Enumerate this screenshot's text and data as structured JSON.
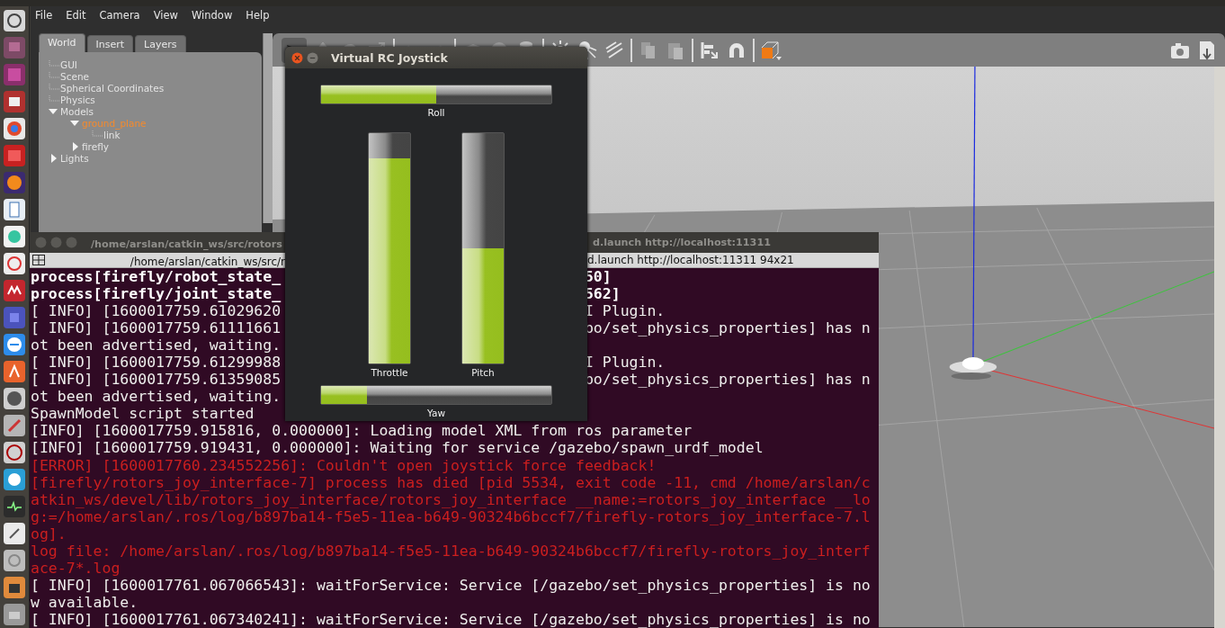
{
  "gazebo": {
    "menu": [
      "File",
      "Edit",
      "Camera",
      "View",
      "Window",
      "Help"
    ],
    "tabs": [
      {
        "label": "World",
        "selected": true
      },
      {
        "label": "Insert",
        "selected": false
      },
      {
        "label": "Layers",
        "selected": false
      }
    ],
    "tree": [
      {
        "label": "GUI",
        "selected": false
      },
      {
        "label": "Scene",
        "selected": false
      },
      {
        "label": "Spherical Coordinates",
        "selected": false
      },
      {
        "label": "Physics",
        "selected": false
      },
      {
        "label": "Models",
        "expanded": true,
        "selected": false,
        "children": [
          {
            "label": "ground_plane",
            "expanded": true,
            "selected": true,
            "children": [
              {
                "label": "link",
                "selected": false
              }
            ]
          },
          {
            "label": "firefly",
            "expanded": false,
            "selected": false
          }
        ]
      },
      {
        "label": "Lights",
        "expanded": false,
        "selected": false
      }
    ]
  },
  "terminal": {
    "title_left": "/home/arslan/catkin_ws/src/rotors",
    "title_right": "d.launch http://localhost:11311",
    "tab_left": "/home/arslan/catkin_ws/src/r",
    "tab_right": "d.launch http://localhost:11311 94x21",
    "lines": [
      {
        "kind": "bold",
        "left": "process[firefly/robot_state_",
        "right": "50]"
      },
      {
        "kind": "bold",
        "left": "process[firefly/joint_state_",
        "right": "562]"
      },
      {
        "kind": "normal",
        "left": "[ INFO] [1600017759.61029620",
        "right": "I Plugin."
      },
      {
        "kind": "normal",
        "left": "[ INFO] [1600017759.61111661",
        "right": "bo/set_physics_properties] has n"
      },
      {
        "kind": "normal",
        "left": "ot been advertised, waiting."
      },
      {
        "kind": "normal",
        "left": "[ INFO] [1600017759.61299988",
        "right": "I Plugin."
      },
      {
        "kind": "normal",
        "left": "[ INFO] [1600017759.61359085",
        "right": "bo/set_physics_properties] has n"
      },
      {
        "kind": "normal",
        "left": "ot been advertised, waiting."
      },
      {
        "kind": "normal",
        "left": "SpawnModel script started"
      },
      {
        "kind": "normal",
        "left": "[INFO] [1600017759.915816, 0.000000]: Loading model XML from ros parameter"
      },
      {
        "kind": "normal",
        "left": "[INFO] [1600017759.919431, 0.000000]: Waiting for service /gazebo/spawn_urdf_model"
      },
      {
        "kind": "error",
        "left": "[ERROR] [1600017760.234552256]: Couldn't open joystick force feedback!"
      },
      {
        "kind": "error",
        "left": "[firefly/rotors_joy_interface-7] process has died [pid 5534, exit code -11, cmd /home/arslan/c"
      },
      {
        "kind": "error",
        "left": "atkin_ws/devel/lib/rotors_joy_interface/rotors_joy_interface __name:=rotors_joy_interface __lo"
      },
      {
        "kind": "error",
        "left": "g:=/home/arslan/.ros/log/b897ba14-f5e5-11ea-b649-90324b6bccf7/firefly-rotors_joy_interface-7.l"
      },
      {
        "kind": "error",
        "left": "og]."
      },
      {
        "kind": "error",
        "left": "log file: /home/arslan/.ros/log/b897ba14-f5e5-11ea-b649-90324b6bccf7/firefly-rotors_joy_interf"
      },
      {
        "kind": "error",
        "left": "ace-7*.log"
      },
      {
        "kind": "normal",
        "left": "[ INFO] [1600017761.067066543]: waitForService: Service [/gazebo/set_physics_properties] is no"
      },
      {
        "kind": "normal",
        "left": "w available."
      },
      {
        "kind": "normal",
        "left": "[ INFO] [1600017761.067340241]: waitForService: Service [/gazebo/set_physics_properties] is no"
      }
    ]
  },
  "joystick": {
    "title": "Virtual RC Joystick",
    "axes": [
      {
        "name": "Roll",
        "kind": "horizontal",
        "level": 0.5
      },
      {
        "name": "Throttle",
        "kind": "vertical",
        "level": 0.89
      },
      {
        "name": "Pitch",
        "kind": "vertical",
        "level": 0.5
      },
      {
        "name": "Yaw",
        "kind": "horizontal",
        "level": 0.2
      }
    ]
  }
}
